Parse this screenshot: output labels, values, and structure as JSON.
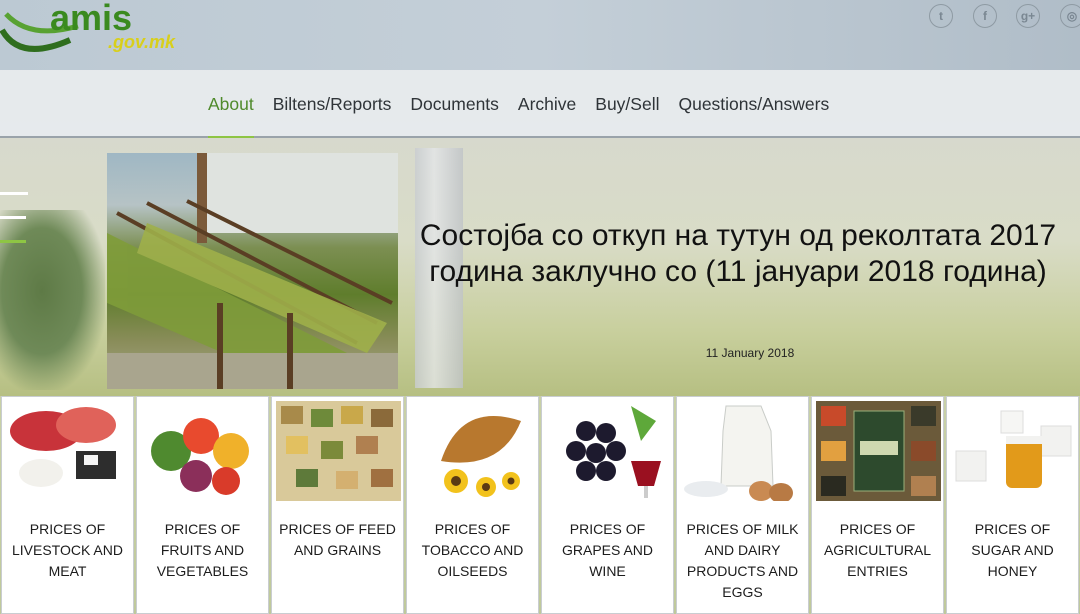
{
  "logo": {
    "text": "amis",
    "sub": ".gov.mk"
  },
  "social": [
    {
      "name": "twitter",
      "glyph": "t"
    },
    {
      "name": "facebook",
      "glyph": "f"
    },
    {
      "name": "google-plus",
      "glyph": "g+"
    },
    {
      "name": "dribbble",
      "glyph": "◎"
    }
  ],
  "nav": [
    {
      "label": "About",
      "active": true
    },
    {
      "label": "Biltens/Reports"
    },
    {
      "label": "Documents"
    },
    {
      "label": "Archive"
    },
    {
      "label": "Buy/Sell"
    },
    {
      "label": "Questions/Answers"
    }
  ],
  "hero": {
    "title": "Состојба со откуп на тутун од реколтата 2017 година заклучно со (11 јануари 2018 година)",
    "date": "11 January 2018"
  },
  "cards": [
    {
      "label": "PRICES OF LIVESTOCK AND MEAT"
    },
    {
      "label": "PRICES OF FRUITS AND VEGETABLES"
    },
    {
      "label": "PRICES OF FEED AND GRAINS"
    },
    {
      "label": "PRICES OF TOBACCO AND OILSEEDS"
    },
    {
      "label": "PRICES OF GRAPES AND WINE"
    },
    {
      "label": "PRICES OF MILK AND DAIRY PRODUCTS AND EGGS"
    },
    {
      "label": "PRICES OF AGRICULTURAL ENTRIES"
    },
    {
      "label": "PRICES OF SUGAR AND HONEY"
    }
  ],
  "colors": {
    "accent": "#8ec544",
    "active_text": "#4f8a2b"
  }
}
